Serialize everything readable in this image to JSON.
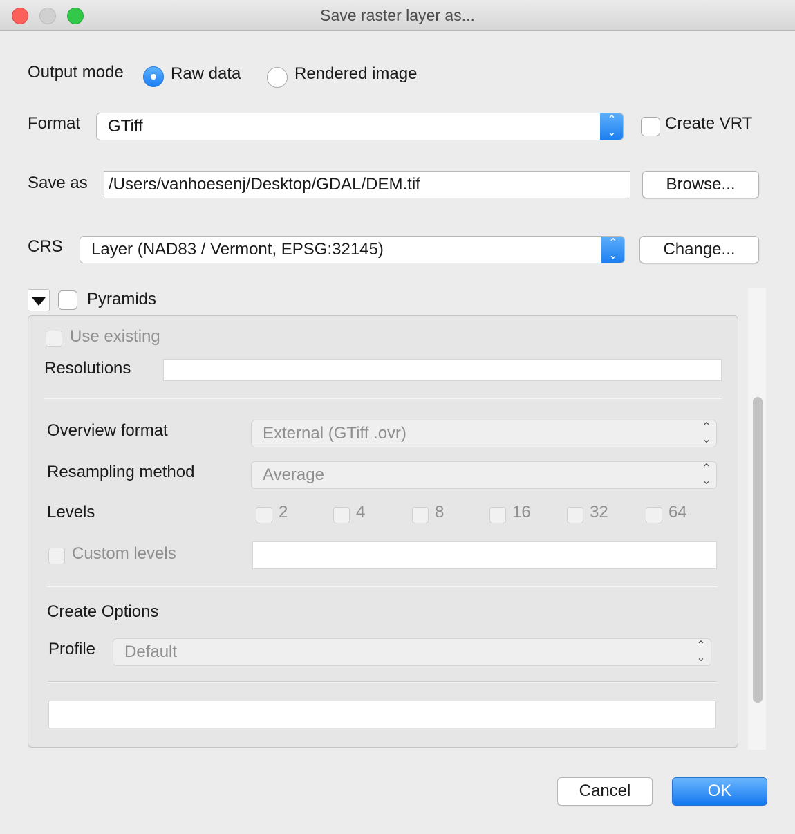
{
  "window": {
    "title": "Save raster layer as..."
  },
  "output_mode": {
    "label": "Output mode",
    "options": [
      "Raw data",
      "Rendered image"
    ],
    "selected": "Raw data"
  },
  "format": {
    "label": "Format",
    "value": "GTiff",
    "create_vrt_label": "Create VRT",
    "create_vrt_checked": false
  },
  "save_as": {
    "label": "Save as",
    "value": "/Users/vanhoesenj/Desktop/GDAL/DEM.tif",
    "browse_label": "Browse..."
  },
  "crs": {
    "label": "CRS",
    "value": "Layer (NAD83 / Vermont, EPSG:32145)",
    "change_label": "Change..."
  },
  "pyramids": {
    "label": "Pyramids",
    "checked": false,
    "use_existing_label": "Use existing",
    "resolutions_label": "Resolutions",
    "resolutions_value": "",
    "overview_format_label": "Overview format",
    "overview_format_value": "External (GTiff .ovr)",
    "resampling_label": "Resampling method",
    "resampling_value": "Average",
    "levels_label": "Levels",
    "levels": [
      "2",
      "4",
      "8",
      "16",
      "32",
      "64"
    ],
    "custom_levels_label": "Custom levels",
    "custom_levels_value": "",
    "create_options_label": "Create Options",
    "profile_label": "Profile",
    "profile_value": "Default",
    "options_value": ""
  },
  "buttons": {
    "cancel": "Cancel",
    "ok": "OK"
  },
  "colors": {
    "accent": "#1b7ef0",
    "window_bg": "#ececec"
  }
}
